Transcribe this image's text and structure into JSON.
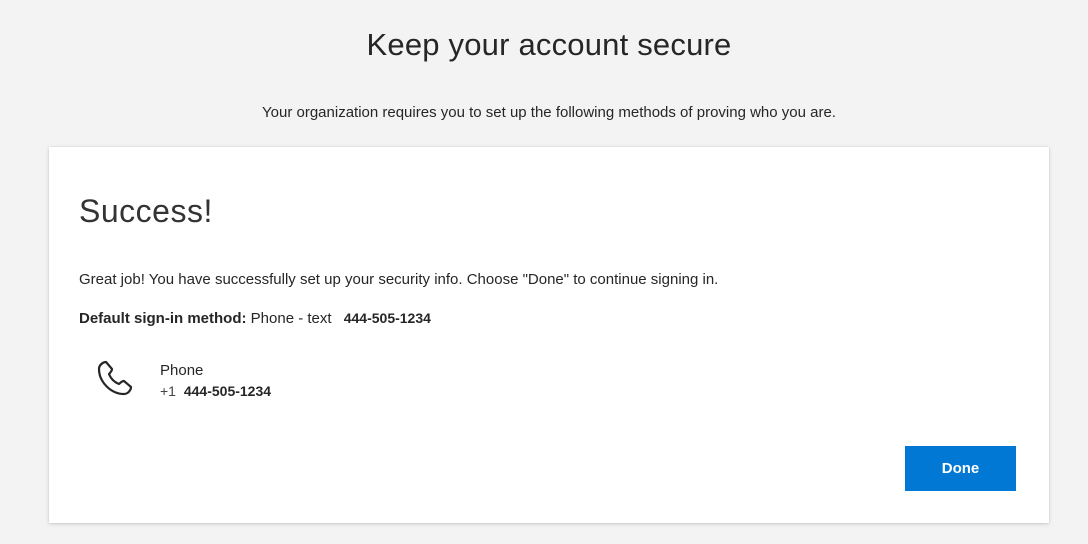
{
  "page": {
    "title": "Keep your account secure",
    "subtitle": "Your organization requires you to set up the following methods of proving who you are."
  },
  "card": {
    "heading": "Success!",
    "message": "Great job! You have successfully set up your security info. Choose \"Done\" to continue signing in.",
    "default_method": {
      "label": "Default sign-in method:",
      "value": "Phone - text",
      "number": "444-505-1234"
    },
    "method": {
      "icon": "phone-icon",
      "name": "Phone",
      "country_code": "+1",
      "number": "444-505-1234"
    },
    "done_label": "Done"
  },
  "colors": {
    "background": "#f3f3f3",
    "card": "#ffffff",
    "accent": "#0078d4",
    "text": "#262626"
  }
}
